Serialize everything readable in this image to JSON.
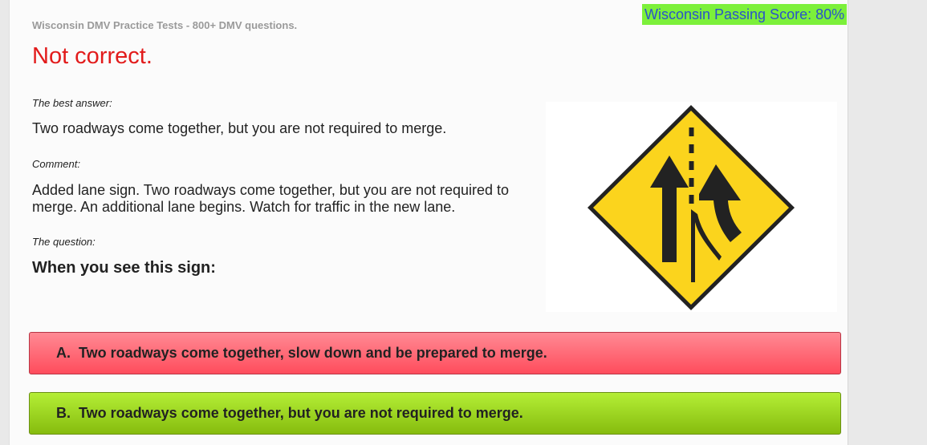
{
  "header": {
    "site_title": "Wisconsin DMV Practice Tests - 800+ DMV questions.",
    "passing_score": "Wisconsin Passing Score: 80%"
  },
  "result": {
    "status": "Not correct.",
    "best_answer_label": "The best answer:",
    "best_answer_text": "Two roadways come together, but you are not required to merge.",
    "comment_label": "Comment:",
    "comment_text": "Added lane sign. Two roadways come together, but you are not required to merge. An additional lane begins. Watch for traffic in the new lane.",
    "question_label": "The question:",
    "question_text": "When you see this sign:"
  },
  "sign": {
    "icon": "added-lane-warning-sign",
    "fill_color": "#fbd41d",
    "border_color": "#222222"
  },
  "options": [
    {
      "letter": "A.",
      "text": "Two roadways come together, slow down and be prepared to merge.",
      "state": "incorrect-selected"
    },
    {
      "letter": "B.",
      "text": "Two roadways come together, but you are not required to merge.",
      "state": "correct"
    }
  ],
  "colors": {
    "incorrect": "#ff5a6a",
    "correct": "#9fd81f",
    "status_text": "#e21b1b",
    "passing_badge_bg": "#7cf03a",
    "passing_badge_text": "#2a53c9"
  }
}
